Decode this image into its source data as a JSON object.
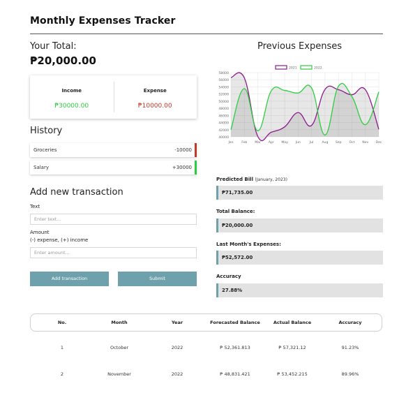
{
  "app": {
    "title": "Monthly Expenses Tracker"
  },
  "total": {
    "label": "Your Total:",
    "value": "₱20,000.00"
  },
  "summary": {
    "income_label": "Income",
    "income_value": "₱30000.00",
    "expense_label": "Expense",
    "expense_value": "₱10000.00"
  },
  "history": {
    "title": "History",
    "items": [
      {
        "name": "Groceries",
        "amount": "-10000"
      },
      {
        "name": "Salary",
        "amount": "+30000"
      }
    ]
  },
  "add_transaction": {
    "title": "Add new transaction",
    "text_label": "Text",
    "text_placeholder": "Enter text...",
    "amount_label": "Amount",
    "amount_hint": "(-) expense, (+) income",
    "amount_placeholder": "Enter amount...",
    "add_button": "Add transaction",
    "submit_button": "Submit"
  },
  "previous_expenses": {
    "title": "Previous Expenses"
  },
  "chart_data": {
    "type": "line",
    "title": "",
    "categories": [
      "Jan",
      "Feb",
      "Mar",
      "Apr",
      "May",
      "Jun",
      "Jul",
      "Aug",
      "Sep",
      "Oct",
      "Nov",
      "Dec"
    ],
    "series": [
      {
        "name": "2021",
        "color": "#8b1a8b",
        "values": [
          56600,
          56500,
          40100,
          41300,
          42800,
          46800,
          43200,
          53300,
          53200,
          51800,
          53200,
          42100
        ]
      },
      {
        "name": "2022",
        "color": "#2ecc40",
        "values": [
          42000,
          53500,
          41700,
          52900,
          53000,
          52300,
          53700,
          40500,
          54200,
          51300,
          43400,
          52600
        ]
      }
    ],
    "ylim": [
      40000,
      58000
    ],
    "yticks": [
      40000,
      42000,
      44000,
      46000,
      48000,
      50000,
      52000,
      54000,
      56000,
      58000
    ],
    "legend": "top-center",
    "grid": true,
    "area_fill": true
  },
  "stats": {
    "predicted_label": "Predicted Bill",
    "predicted_sub": "(January, 2023)",
    "predicted_value": "₱71,735.00",
    "balance_label": "Total Balance:",
    "balance_value": "₱20,000.00",
    "last_month_label": "Last Month's Expenses:",
    "last_month_value": "₱52,572.00",
    "accuracy_label": "Accuracy",
    "accuracy_value": "27.88%"
  },
  "table": {
    "headers": [
      "No.",
      "Month",
      "Year",
      "Forecasted Balance",
      "Actual Balance",
      "Accuracy"
    ],
    "rows": [
      [
        "1",
        "October",
        "2022",
        "₱ 52,361.813",
        "₱ 57,321.12",
        "91.23%"
      ],
      [
        "2",
        "November",
        "2022",
        "₱ 48,831.421",
        "₱ 53,452.215",
        "89.96%"
      ]
    ]
  },
  "colors": {
    "accent": "#6fa1ad",
    "income": "#2ecc40",
    "expense": "#c0392b",
    "series_2021": "#8b1a8b",
    "series_2022": "#2ecc40"
  }
}
